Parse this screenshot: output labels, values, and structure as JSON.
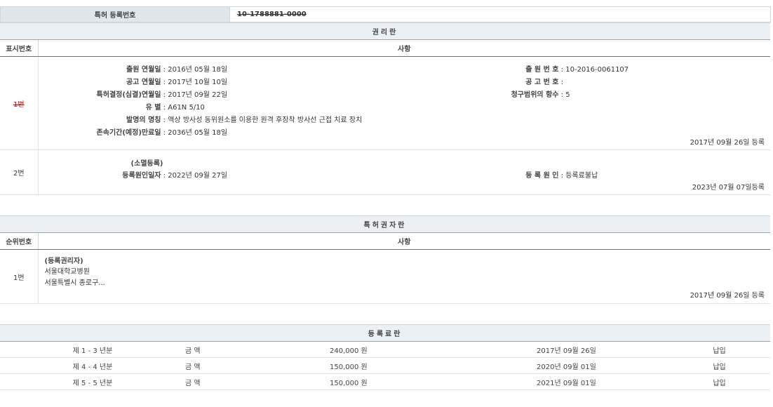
{
  "top": {
    "label": "특허 등록번호",
    "value": "10-1788881-0000"
  },
  "rights": {
    "title": "권리란",
    "col_num": "표시번호",
    "col_item": "사항",
    "row1": {
      "num": "1번",
      "apply_date_key": "출원 연월일",
      "apply_date_val": "2016년 05월 18일",
      "pub_date_key": "공고 연월일",
      "pub_date_val": "2017년 10월 10일",
      "decision_key": "특허결정(심결)연월일",
      "decision_val": "2017년 09월 22일",
      "type_key": "유 별",
      "type_val": "A61N 5/10",
      "name_key": "발명의 명칭",
      "name_val": "액상 방사성 동위원소를 이용한 원격 후장착 방사선 근접 치료 장치",
      "expire_key": "존속기간(예정)만료일",
      "expire_val": "2036년 05월 18일",
      "apply_no_key": "출 원 번 호",
      "apply_no_val": "10-2016-0061107",
      "pub_no_key": "공 고 번 호",
      "pub_no_val": "",
      "claims_key": "청구범위의 항수",
      "claims_val": "5",
      "reg_date": "2017년 09월 26일 등록"
    },
    "row2": {
      "num": "2번",
      "heading": "(소멸등록)",
      "cause_date_key": "등록원인일자",
      "cause_date_val": "2022년 09월 27일",
      "cause_key": "등 록 원 인",
      "cause_val": "등록료불납",
      "reg_date": "2023년 07월 07일등록"
    }
  },
  "holders": {
    "title": "특허권자란",
    "col_num": "순위번호",
    "col_item": "사항",
    "row1": {
      "num": "1번",
      "heading": "(등록권리자)",
      "name": "서울대학교병원",
      "address": "서울특별시 종로구...",
      "reg_date": "2017년 09월 26일 등록"
    }
  },
  "fees": {
    "title": "등록료란",
    "rows": [
      {
        "period": "제 1 - 3 년분",
        "label": "금 액",
        "amount": "240,000 원",
        "date": "2017년 09월 26일",
        "status": "납입"
      },
      {
        "period": "제 4 - 4 년분",
        "label": "금 액",
        "amount": "150,000 원",
        "date": "2020년 09월 01일",
        "status": "납입"
      },
      {
        "period": "제 5 - 5 년분",
        "label": "금 액",
        "amount": "150,000 원",
        "date": "2021년 09월 01일",
        "status": "납입"
      }
    ]
  }
}
